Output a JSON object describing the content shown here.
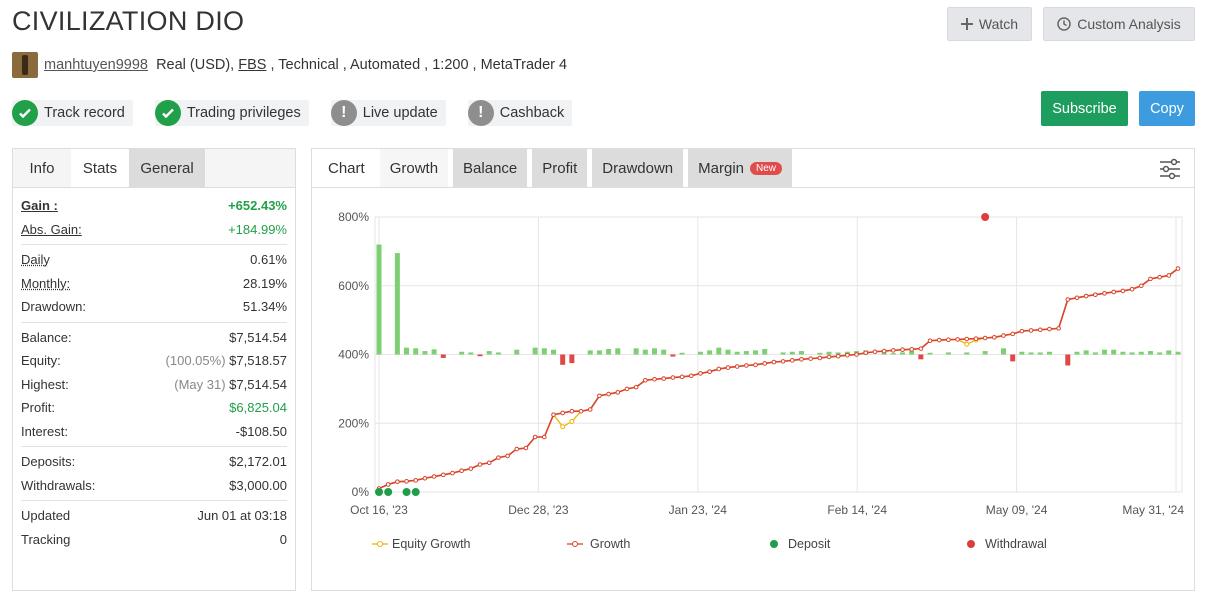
{
  "header": {
    "title": "CIVILIZATION DIO",
    "watch_label": "Watch",
    "custom_label": "Custom Analysis"
  },
  "account": {
    "username": "manhtuyen9998",
    "details_prefix": "Real (USD), ",
    "broker": "FBS",
    "details_suffix": " , Technical , Automated , 1:200 , MetaTrader 4"
  },
  "badges": [
    {
      "label": "Track record",
      "status": "ok"
    },
    {
      "label": "Trading privileges",
      "status": "ok"
    },
    {
      "label": "Live update",
      "status": "warn"
    },
    {
      "label": "Cashback",
      "status": "warn"
    }
  ],
  "actions": {
    "subscribe": "Subscribe",
    "copy": "Copy"
  },
  "left_tabs": [
    "Info",
    "Stats",
    "General"
  ],
  "stats": {
    "gain_label": "Gain :",
    "gain": "+652.43%",
    "abs_gain_label": "Abs. Gain:",
    "abs_gain": "+184.99%",
    "daily_label": "Daily",
    "daily": "0.61%",
    "monthly_label": "Monthly:",
    "monthly": "28.19%",
    "drawdown_label": "Drawdown:",
    "drawdown": "51.34%",
    "balance_label": "Balance:",
    "balance": "$7,514.54",
    "equity_label": "Equity:",
    "equity_pct": "(100.05%)",
    "equity": "$7,518.57",
    "highest_label": "Highest:",
    "highest_date": "(May 31)",
    "highest": "$7,514.54",
    "profit_label": "Profit:",
    "profit": "$6,825.04",
    "interest_label": "Interest:",
    "interest": "-$108.50",
    "deposits_label": "Deposits:",
    "deposits": "$2,172.01",
    "withdrawals_label": "Withdrawals:",
    "withdrawals": "$3,000.00",
    "updated_label": "Updated",
    "updated": "Jun 01 at 03:18",
    "tracking_label": "Tracking",
    "tracking": "0"
  },
  "chart_tabs": {
    "chart": "Chart",
    "growth": "Growth",
    "balance": "Balance",
    "profit": "Profit",
    "drawdown": "Drawdown",
    "margin": "Margin",
    "new_badge": "New"
  },
  "chart_data": {
    "type": "line",
    "y_ticks": [
      "800%",
      "600%",
      "400%",
      "200%",
      "0%"
    ],
    "y_values": [
      800,
      600,
      400,
      200,
      0
    ],
    "ylim": [
      0,
      800
    ],
    "x_ticks": [
      "Oct 16, '23",
      "Dec 28, '23",
      "Jan 23, '24",
      "Feb 14, '24",
      "May 09, '24",
      "May 31, '24"
    ],
    "legend": [
      "Equity Growth",
      "Growth",
      "Deposit",
      "Withdrawal"
    ],
    "colors": {
      "growth": "#d9442b",
      "equity": "#f0b400",
      "deposit": "#1e9e4a",
      "withdrawal": "#e03b3b",
      "bar_pos": "#7ccf72",
      "bar_neg": "#e04848"
    },
    "growth": [
      10,
      22,
      30,
      31,
      34,
      40,
      45,
      50,
      55,
      62,
      68,
      80,
      85,
      100,
      105,
      125,
      128,
      160,
      160,
      225,
      230,
      235,
      235,
      240,
      280,
      285,
      290,
      300,
      305,
      325,
      328,
      330,
      333,
      335,
      338,
      345,
      350,
      358,
      362,
      365,
      368,
      370,
      374,
      378,
      380,
      383,
      386,
      388,
      390,
      393,
      395,
      398,
      400,
      405,
      408,
      410,
      412,
      414,
      415,
      417,
      440,
      442,
      443,
      444,
      445,
      446,
      448,
      450,
      455,
      460,
      468,
      470,
      472,
      474,
      476,
      560,
      565,
      570,
      574,
      578,
      582,
      585,
      590,
      600,
      620,
      625,
      630,
      650
    ],
    "equity_dips": [
      {
        "index": 20,
        "value": 190
      },
      {
        "index": 21,
        "value": 205
      },
      {
        "index": 64,
        "value": 430
      },
      {
        "index": 65,
        "value": 442
      }
    ],
    "daily_bars": [
      320,
      0,
      295,
      0,
      0,
      0,
      0,
      0,
      0,
      0,
      0,
      0,
      0,
      0,
      0,
      0,
      0,
      0,
      0,
      0,
      0,
      0,
      0,
      0,
      0,
      0,
      0,
      0,
      0,
      0,
      0,
      0,
      0,
      0,
      0,
      0,
      0,
      0,
      0,
      0,
      0,
      0,
      0,
      0,
      0,
      0,
      0,
      0,
      0,
      0,
      0,
      0,
      0,
      0,
      0,
      0,
      0,
      0,
      0,
      0,
      0,
      0,
      0,
      0,
      0,
      0,
      0,
      0,
      0,
      0,
      0,
      0,
      0,
      0,
      0,
      0,
      0,
      0,
      0,
      0,
      0,
      0,
      0,
      0,
      0,
      0,
      0,
      0
    ],
    "small_bars": [
      0,
      0,
      0,
      20,
      18,
      10,
      15,
      -10,
      0,
      8,
      6,
      -5,
      10,
      6,
      0,
      14,
      0,
      20,
      18,
      14,
      -30,
      -25,
      0,
      12,
      12,
      16,
      18,
      0,
      18,
      14,
      18,
      14,
      -6,
      5,
      0,
      8,
      12,
      20,
      14,
      8,
      10,
      12,
      16,
      0,
      6,
      8,
      10,
      0,
      5,
      8,
      6,
      8,
      10,
      12,
      0,
      8,
      4,
      6,
      10,
      -14,
      5,
      0,
      6,
      0,
      6,
      0,
      10,
      0,
      18,
      -20,
      8,
      6,
      6,
      8,
      0,
      -32,
      8,
      12,
      6,
      14,
      14,
      8,
      6,
      8,
      10,
      6,
      12,
      8
    ],
    "deposits_at": [
      0,
      1,
      3,
      4
    ],
    "withdrawal_point": {
      "index": 66,
      "value": 800
    }
  }
}
